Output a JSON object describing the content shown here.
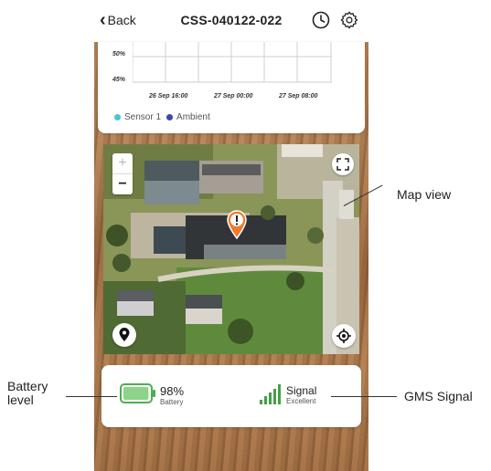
{
  "header": {
    "back_label": "Back",
    "title": "CSS-040122-022",
    "icons": [
      "history-icon",
      "gear-icon"
    ]
  },
  "chart_data": {
    "type": "line",
    "y_ticks": [
      "50%",
      "45%"
    ],
    "x_ticks": [
      "26 Sep 16:00",
      "27 Sep 00:00",
      "27 Sep 08:00"
    ],
    "series": [
      {
        "name": "Sensor 1",
        "color": "#4cc3d9",
        "values": []
      },
      {
        "name": "Ambient",
        "color": "#3b4aa8",
        "values": []
      }
    ],
    "grid": true
  },
  "map": {
    "controls": {
      "zoom_in": "+",
      "zoom_out": "−"
    },
    "icons": [
      "expand-icon",
      "location-pin-icon",
      "locate-icon",
      "alert-marker-icon"
    ]
  },
  "status": {
    "battery_value": "98%",
    "battery_label": "Battery",
    "battery_level": 0.98,
    "battery_color": "#4caf50",
    "signal_value": "Signal",
    "signal_label": "Excellent",
    "signal_color": "#43a047"
  },
  "annotations": {
    "map_view": "Map view",
    "battery_level": "Battery\nlevel",
    "gms_signal": "GMS Signal"
  }
}
